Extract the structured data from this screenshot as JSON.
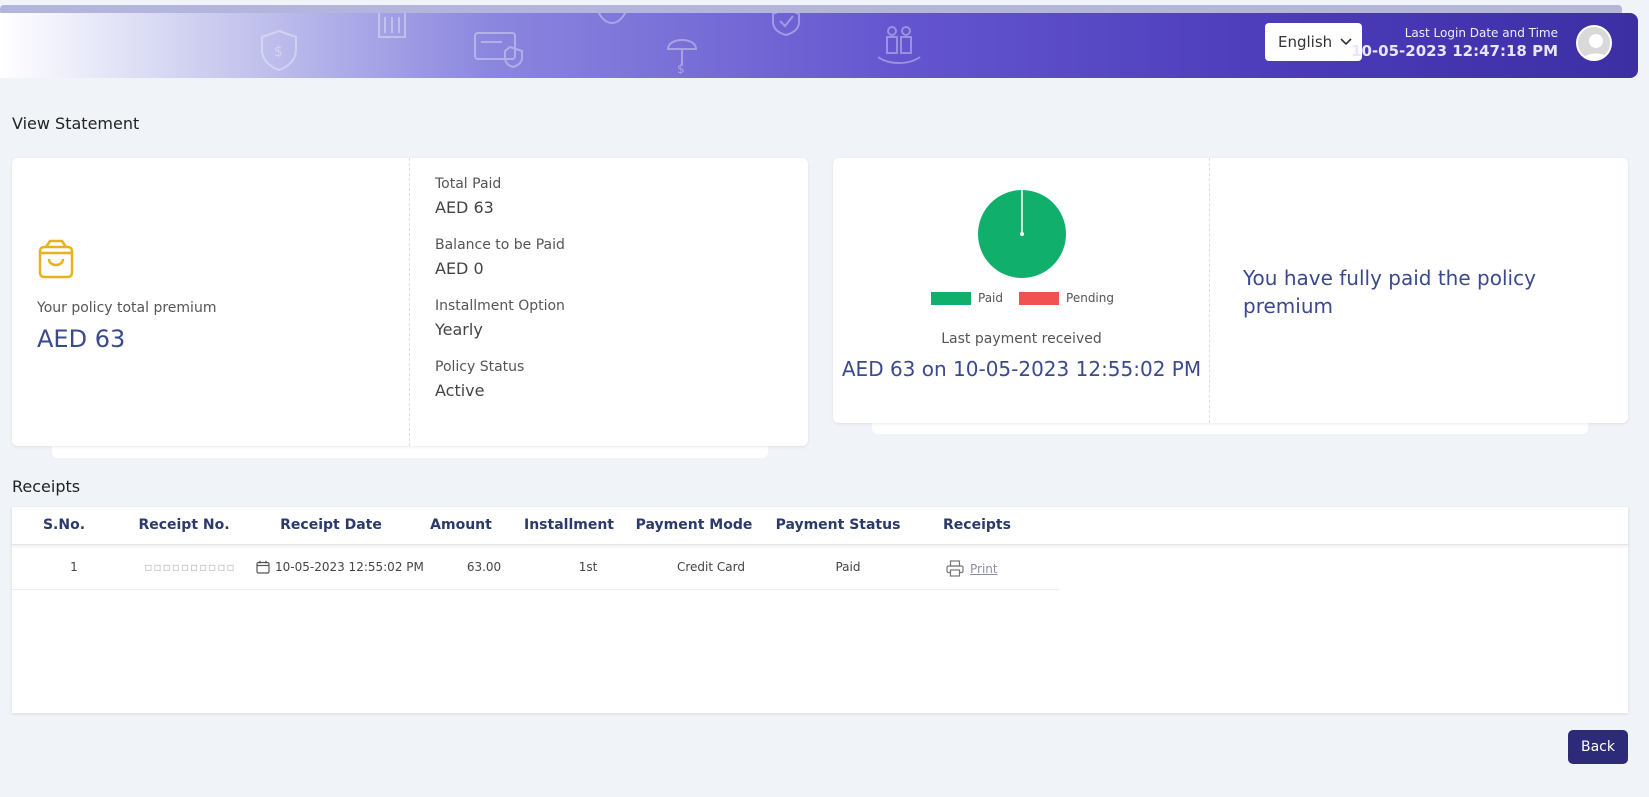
{
  "header": {
    "language": "English",
    "last_login_label": "Last Login Date and Time",
    "last_login_value": "10-05-2023 12:47:18 PM"
  },
  "page": {
    "title": "View Statement"
  },
  "premium": {
    "label": "Your policy total premium",
    "amount": "AED 63",
    "details": [
      {
        "label": "Total Paid",
        "value": "AED 63"
      },
      {
        "label": "Balance to be Paid",
        "value": "AED 0"
      },
      {
        "label": "Installment Option",
        "value": "Yearly"
      },
      {
        "label": "Policy Status",
        "value": "Active"
      }
    ]
  },
  "payment": {
    "legend_paid": "Paid",
    "legend_pending": "Pending",
    "paid_color": "#10b06c",
    "pending_color": "#f05252",
    "paid_fraction": 1.0,
    "last_payment_label": "Last payment received",
    "last_payment_value": "AED 63 on 10-05-2023 12:55:02 PM",
    "message": "You have fully paid the policy premium"
  },
  "receipts": {
    "title": "Receipts",
    "columns": [
      "S.No.",
      "Receipt No.",
      "Receipt Date",
      "Amount",
      "Installment",
      "Payment Mode",
      "Payment Status",
      "Receipts"
    ],
    "rows": [
      {
        "sno": "1",
        "receipt_no": "▫▫▫▫▫▫▫▫▫▫",
        "date": "10-05-2023 12:55:02 PM",
        "amount": "63.00",
        "installment": "1st",
        "mode": "Credit Card",
        "status": "Paid",
        "action": "Print"
      }
    ]
  },
  "buttons": {
    "back": "Back"
  }
}
